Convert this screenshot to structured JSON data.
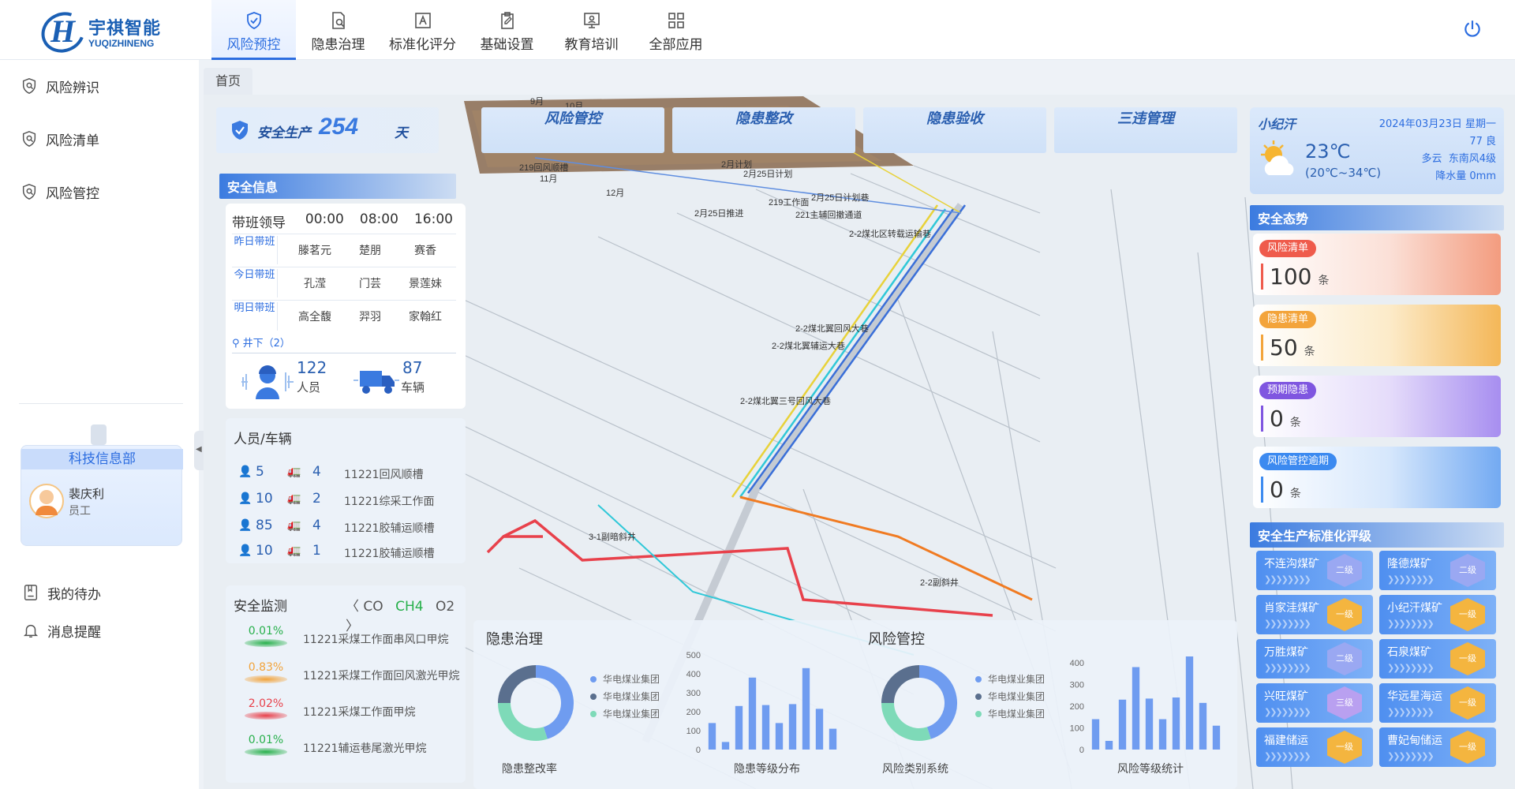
{
  "brand": {
    "name_cn": "宇祺智能",
    "name_en": "YUQIZHINENG"
  },
  "top_tabs": [
    {
      "label": "风险预控",
      "active": true
    },
    {
      "label": "隐患治理"
    },
    {
      "label": "标准化评分"
    },
    {
      "label": "基础设置"
    },
    {
      "label": "教育培训"
    },
    {
      "label": "全部应用"
    }
  ],
  "sidebar": {
    "items": [
      {
        "label": "风险辨识"
      },
      {
        "label": "风险清单"
      },
      {
        "label": "风险管控"
      }
    ],
    "department": "科技信息部",
    "user_name": "裴庆利",
    "user_role": "员工",
    "bottom_items": [
      {
        "label": "我的待办"
      },
      {
        "label": "消息提醒"
      }
    ]
  },
  "breadcrumb": {
    "home": "首页"
  },
  "top_bar": {
    "safety_prefix": "安全生产",
    "safety_days": "254",
    "safety_unit": "天",
    "tabs": [
      "风险管控",
      "隐患整改",
      "隐患验收",
      "三违管理"
    ]
  },
  "safety_info": {
    "title": "安全信息",
    "leader_title": "带班领导",
    "times": [
      "00:00",
      "08:00",
      "16:00"
    ],
    "rows": [
      {
        "label": "昨日带班",
        "names": [
          "滕茗元",
          "楚朋",
          "赛香"
        ]
      },
      {
        "label": "今日带班",
        "names": [
          "孔滢",
          "门芸",
          "景莲妹"
        ]
      },
      {
        "label": "明日带班",
        "names": [
          "高全馥",
          "羿羽",
          "家翰红"
        ]
      }
    ],
    "location": "井下（2）",
    "people_count": "122",
    "people_label": "人员",
    "vehicle_count": "87",
    "vehicle_label": "车辆"
  },
  "person_vehicle": {
    "title": "人员/车辆",
    "rows": [
      {
        "people": "5",
        "vehicles": "4",
        "place": "11221回风顺槽"
      },
      {
        "people": "10",
        "vehicles": "2",
        "place": "11221综采工作面"
      },
      {
        "people": "85",
        "vehicles": "4",
        "place": "11221胶辅运顺槽"
      },
      {
        "people": "10",
        "vehicles": "1",
        "place": "11221胶辅运顺槽"
      }
    ]
  },
  "monitoring": {
    "title": "安全监测",
    "gases": [
      "CO",
      "CH4",
      "O2"
    ],
    "active_gas": "CH4",
    "rows": [
      {
        "pct": "0.01%",
        "name": "11221采煤工作面串风口甲烷",
        "color": "#27b04b"
      },
      {
        "pct": "0.83%",
        "name": "11221采煤工作面回风激光甲烷",
        "color": "#f2a33a"
      },
      {
        "pct": "2.02%",
        "name": "11221采煤工作面甲烷",
        "color": "#e8414b"
      },
      {
        "pct": "0.01%",
        "name": "11221辅运巷尾激光甲烷",
        "color": "#27b04b"
      }
    ]
  },
  "hazard_panel": {
    "title": "隐患治理",
    "donut_label": "隐患整改率",
    "bar_label": "隐患等级分布",
    "legend": [
      "华电煤业集团",
      "华电煤业集团",
      "华电煤业集团"
    ],
    "y_ticks": [
      "500",
      "400",
      "300",
      "200",
      "100",
      "0"
    ]
  },
  "risk_panel": {
    "title": "风险管控",
    "donut_label": "风险类别系统",
    "bar_label": "风险等级统计",
    "legend": [
      "华电煤业集团",
      "华电煤业集团",
      "华电煤业集团"
    ],
    "y_ticks": [
      "400",
      "300",
      "200",
      "100",
      "0"
    ]
  },
  "chart_data": [
    {
      "type": "bar",
      "title": "隐患等级分布",
      "ylim": [
        0,
        500
      ],
      "values": [
        140,
        40,
        230,
        380,
        235,
        140,
        240,
        430,
        215,
        110
      ]
    },
    {
      "type": "bar",
      "title": "风险等级统计",
      "ylim": [
        0,
        400
      ],
      "values": [
        140,
        40,
        230,
        380,
        235,
        140,
        240,
        430,
        215,
        110
      ]
    },
    {
      "type": "pie",
      "title": "隐患整改率",
      "values": [
        45,
        30,
        25
      ],
      "colors": [
        "#6f9cf0",
        "#7edab8",
        "#5a6f8e"
      ]
    },
    {
      "type": "pie",
      "title": "风险类别系统",
      "values": [
        45,
        30,
        25
      ],
      "colors": [
        "#6f9cf0",
        "#7edab8",
        "#5a6f8e"
      ]
    }
  ],
  "weather": {
    "location": "小纪汗",
    "date": "2024年03月23日 星期一",
    "aqi": "77 良",
    "temp": "23℃",
    "range": "(20℃~34℃)",
    "condition": "多云",
    "wind": "东南风4级",
    "rain": "降水量 0mm"
  },
  "safety_trend": {
    "title": "安全态势",
    "cards": [
      {
        "tag": "风险清单",
        "value": "100",
        "unit": "条",
        "color": "#ef5b4c"
      },
      {
        "tag": "隐患清单",
        "value": "50",
        "unit": "条",
        "color": "#f3a43b"
      },
      {
        "tag": "预期隐患",
        "value": "0",
        "unit": "条",
        "color": "#7f56e0"
      },
      {
        "tag": "风险管控逾期",
        "value": "0",
        "unit": "条",
        "color": "#3c8af0"
      }
    ]
  },
  "standard_rating": {
    "title": "安全生产标准化评级",
    "mines": [
      {
        "name": "不连沟煤矿",
        "grade": "二级"
      },
      {
        "name": "隆德煤矿",
        "grade": "二级"
      },
      {
        "name": "肖家洼煤矿",
        "grade": "一级"
      },
      {
        "name": "小纪汗煤矿",
        "grade": "一级"
      },
      {
        "name": "万胜煤矿",
        "grade": "二级"
      },
      {
        "name": "石泉煤矿",
        "grade": "一级"
      },
      {
        "name": "兴旺煤矿",
        "grade": "三级"
      },
      {
        "name": "华远星海运",
        "grade": "一级"
      },
      {
        "name": "福建储运",
        "grade": "一级"
      },
      {
        "name": "曹妃甸储运",
        "grade": "一级"
      }
    ]
  },
  "map_labels": [
    "9月",
    "10月",
    "219回风顺槽",
    "11月",
    "12月",
    "2月计划",
    "2月25日计划",
    "219工作面",
    "2月25日计划巷",
    "2月25日推进",
    "221主辅回撤通道",
    "2-2煤北区转载运输巷",
    "2-2煤北翼回风大巷",
    "2-2煤北翼辅运大巷",
    "2-2煤北翼三号回风大巷",
    "3-1副暗斜井",
    "2-2副斜井"
  ],
  "colors": {
    "accent": "#2c6de0",
    "danger": "#e8414b",
    "warning": "#f3a43b",
    "success": "#27b04b"
  }
}
